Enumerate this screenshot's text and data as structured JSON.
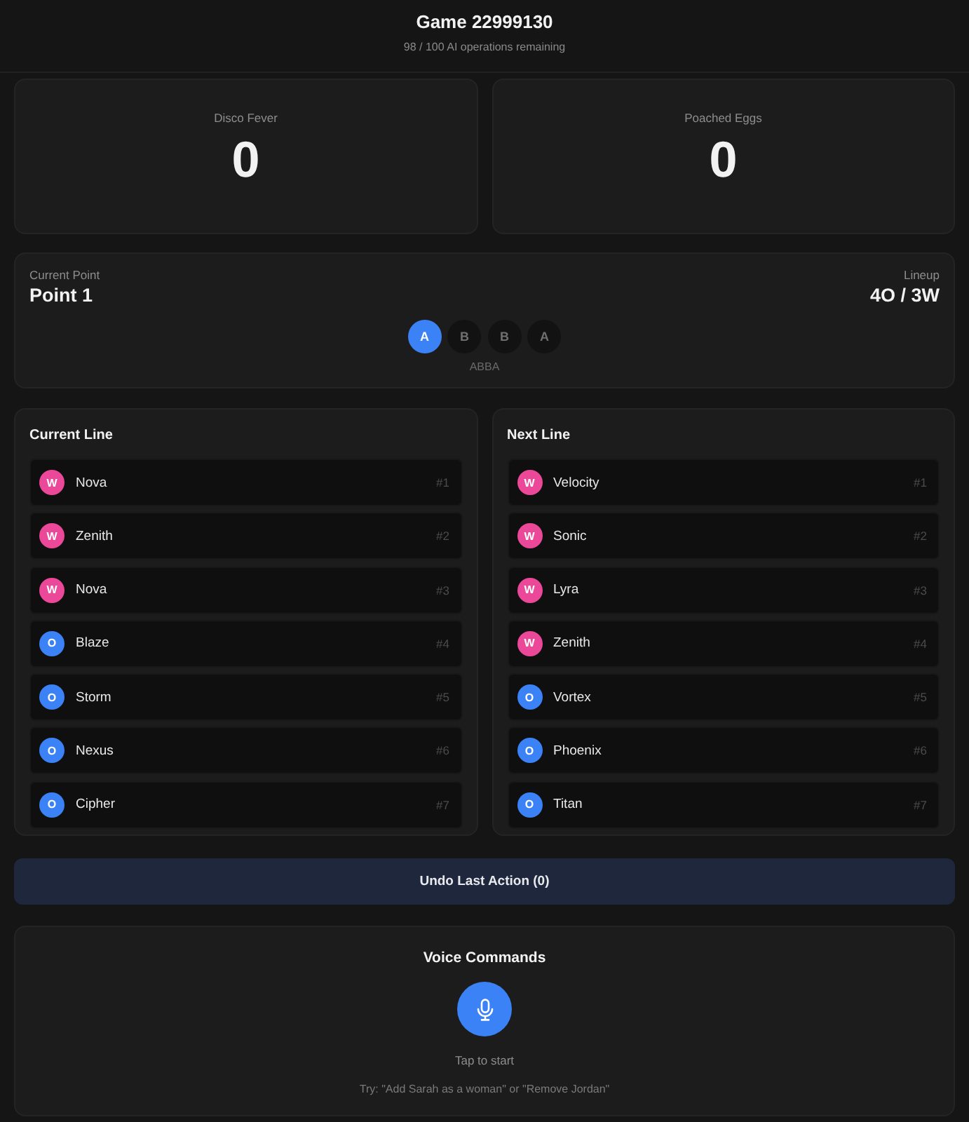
{
  "header": {
    "title": "Game 22999130",
    "subtitle": "98 / 100 AI operations remaining"
  },
  "scores": [
    {
      "team": "Disco Fever",
      "score": "0"
    },
    {
      "team": "Poached Eggs",
      "score": "0"
    }
  ],
  "point": {
    "label": "Current Point",
    "value": "Point 1",
    "lineup_label": "Lineup",
    "lineup_value": "4O / 3W",
    "pattern": [
      {
        "letter": "A",
        "selected": true
      },
      {
        "letter": "B",
        "selected": false
      },
      {
        "letter": "B",
        "selected": false
      },
      {
        "letter": "A",
        "selected": false
      }
    ],
    "pattern_label": "ABBA"
  },
  "lines": [
    {
      "title": "Current Line",
      "players": [
        {
          "badge": "W",
          "color": "#ec4899",
          "name": "Nova",
          "number": "#1"
        },
        {
          "badge": "W",
          "color": "#ec4899",
          "name": "Zenith",
          "number": "#2"
        },
        {
          "badge": "W",
          "color": "#ec4899",
          "name": "Nova",
          "number": "#3"
        },
        {
          "badge": "O",
          "color": "#3b82f6",
          "name": "Blaze",
          "number": "#4"
        },
        {
          "badge": "O",
          "color": "#3b82f6",
          "name": "Storm",
          "number": "#5"
        },
        {
          "badge": "O",
          "color": "#3b82f6",
          "name": "Nexus",
          "number": "#6"
        },
        {
          "badge": "O",
          "color": "#3b82f6",
          "name": "Cipher",
          "number": "#7"
        }
      ]
    },
    {
      "title": "Next Line",
      "players": [
        {
          "badge": "W",
          "color": "#ec4899",
          "name": "Velocity",
          "number": "#1"
        },
        {
          "badge": "W",
          "color": "#ec4899",
          "name": "Sonic",
          "number": "#2"
        },
        {
          "badge": "W",
          "color": "#ec4899",
          "name": "Lyra",
          "number": "#3"
        },
        {
          "badge": "W",
          "color": "#ec4899",
          "name": "Zenith",
          "number": "#4"
        },
        {
          "badge": "O",
          "color": "#3b82f6",
          "name": "Vortex",
          "number": "#5"
        },
        {
          "badge": "O",
          "color": "#3b82f6",
          "name": "Phoenix",
          "number": "#6"
        },
        {
          "badge": "O",
          "color": "#3b82f6",
          "name": "Titan",
          "number": "#7"
        }
      ]
    }
  ],
  "undo_button": "Undo Last Action (0)",
  "voice": {
    "title": "Voice Commands",
    "hint": "Tap to start",
    "example": "Try: \"Add Sarah as a woman\" or \"Remove Jordan\""
  }
}
